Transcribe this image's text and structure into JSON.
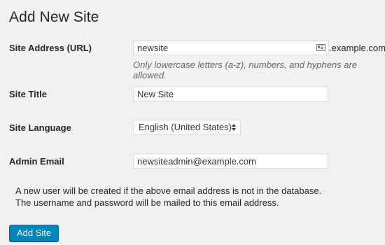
{
  "page": {
    "title": "Add New Site"
  },
  "form": {
    "site_address": {
      "label": "Site Address (URL)",
      "value": "newsite",
      "suffix": ".example.com",
      "hint": "Only lowercase letters (a-z), numbers, and hyphens are allowed."
    },
    "site_title": {
      "label": "Site Title",
      "value": "New Site"
    },
    "site_language": {
      "label": "Site Language",
      "selected": "English (United States)"
    },
    "admin_email": {
      "label": "Admin Email",
      "value": "newsiteadmin@example.com"
    },
    "note_lines": [
      "A new user will be created if the above email address is not in the database.",
      "The username and password will be mailed to this email address."
    ],
    "submit_label": "Add Site"
  },
  "colors": {
    "background": "#f1f1f1",
    "primary": "#0085ba",
    "primary_border": "#006799",
    "text": "#23282d",
    "hint_text": "#666666"
  }
}
